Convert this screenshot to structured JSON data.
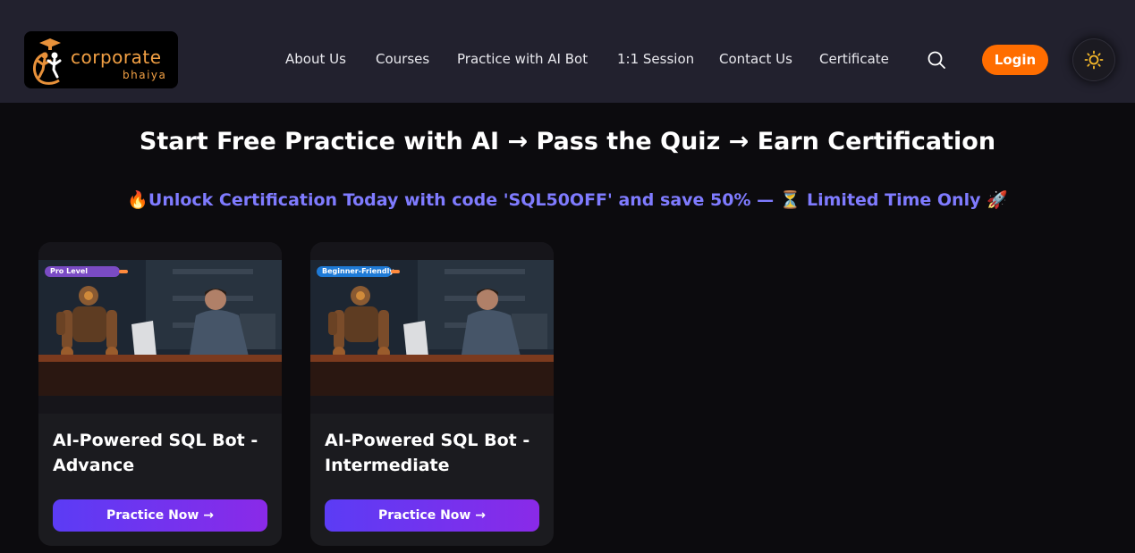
{
  "brand": {
    "name_line1": "corporate",
    "name_line2": "bhaiya",
    "accent_color": "#ff6d00"
  },
  "nav": {
    "items": [
      {
        "label": "About Us"
      },
      {
        "label": "Courses"
      },
      {
        "label": "Practice with AI Bot"
      },
      {
        "label": "1:1 Session"
      },
      {
        "label": "Contact Us"
      },
      {
        "label": "Certificate"
      }
    ],
    "search_icon": "search-icon",
    "login_label": "Login",
    "theme_icon": "sun-icon"
  },
  "hero": {
    "title": "Start Free Practice with AI → Pass the Quiz → Earn Certification",
    "promo": "🔥Unlock Certification Today with code 'SQL50OFF' and save 50% — ⏳ Limited Time Only 🚀",
    "promo_color": "#7f7bff"
  },
  "cards": [
    {
      "badge": "Pro Level",
      "title": "AI-Powered SQL Bot - Advance",
      "button_label": "Practice Now →"
    },
    {
      "badge": "Beginner-Friendly",
      "title": "AI-Powered SQL Bot - Intermediate",
      "button_label": "Practice Now →"
    }
  ]
}
